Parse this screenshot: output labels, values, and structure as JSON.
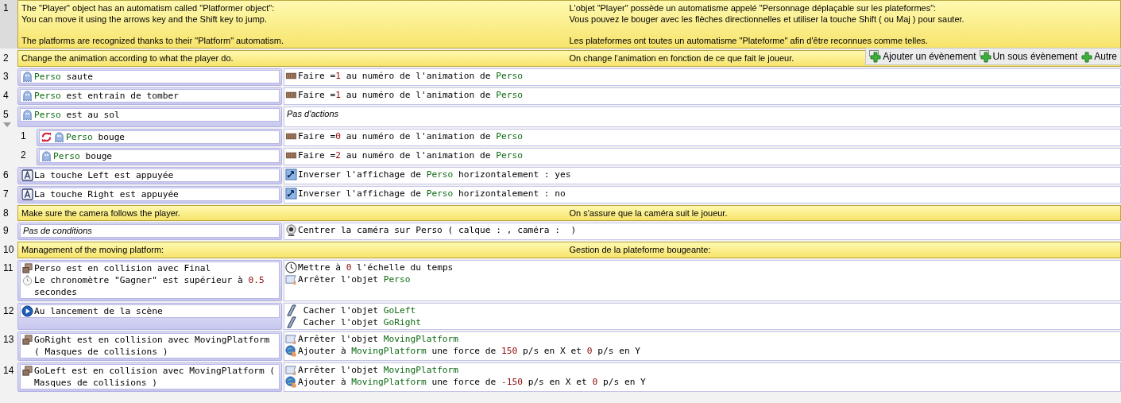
{
  "events": [
    {
      "kind": "comment",
      "number": "1",
      "en": "The \"Player\" object has an automatism called \"Platformer object\":\nYou can move it using the arrows key and the Shift key to jump.\n\nThe platforms are recognized thanks to their \"Platform\" automatism.",
      "fr": "L'objet \"Player\" possède un automatisme appelé \"Personnage déplaçable sur les plateformes\":\nVous pouvez le bouger avec les flèches directionnelles et utiliser la touche Shift ( ou Maj ) pour sauter.\n\nLes plateformes ont toutes un automatisme \"Plateforme\" afin d'être reconnues comme telles."
    },
    {
      "kind": "comment",
      "number": "2",
      "en": "Change the animation according to what the player do.",
      "fr": "On change l'animation en fonction de ce que fait le joueur.",
      "toolbar": [
        "Ajouter un évènement",
        "Un sous évènement",
        "Autre"
      ]
    },
    {
      "kind": "standard",
      "number": "3",
      "expanded": false,
      "conditions": [
        {
          "kind": "sprite",
          "once": false,
          "parts": [
            {
              "object": "Perso"
            },
            " saute"
          ]
        }
      ],
      "actions": [
        {
          "kind": "animation",
          "parts": [
            "Faire =",
            {
              "value": "1"
            },
            " au numéro de l'animation de ",
            {
              "object": "Perso"
            }
          ]
        }
      ]
    },
    {
      "kind": "standard",
      "number": "4",
      "expanded": false,
      "conditions": [
        {
          "kind": "sprite",
          "once": false,
          "parts": [
            {
              "object": "Perso"
            },
            " est entrain de tomber"
          ]
        }
      ],
      "actions": [
        {
          "kind": "animation",
          "parts": [
            "Faire =",
            {
              "value": "1"
            },
            " au numéro de l'animation de ",
            {
              "object": "Perso"
            }
          ]
        }
      ]
    },
    {
      "kind": "standard",
      "number": "5",
      "expanded": true,
      "conditions": [
        {
          "kind": "sprite",
          "once": false,
          "parts": [
            {
              "object": "Perso"
            },
            " est au sol"
          ]
        }
      ],
      "actions": [
        {
          "kind": "none",
          "parts": [
            "Pas d'actions"
          ]
        }
      ],
      "children": [
        {
          "number": "1",
          "conditions": [
            {
              "kind": "sprite",
              "once": true,
              "parts": [
                {
                  "object": "Perso"
                },
                " bouge"
              ]
            }
          ],
          "actions": [
            {
              "kind": "animation",
              "parts": [
                "Faire =",
                {
                  "value": "0"
                },
                " au numéro de l'animation de ",
                {
                  "object": "Perso"
                }
              ]
            }
          ]
        },
        {
          "number": "2",
          "conditions": [
            {
              "kind": "sprite",
              "once": false,
              "parts": [
                {
                  "object": "Perso"
                },
                " bouge"
              ]
            }
          ],
          "actions": [
            {
              "kind": "animation",
              "parts": [
                "Faire =",
                {
                  "value": "2"
                },
                " au numéro de l'animation de ",
                {
                  "object": "Perso"
                }
              ]
            }
          ]
        }
      ]
    },
    {
      "kind": "standard",
      "number": "6",
      "expanded": false,
      "conditions": [
        {
          "kind": "key",
          "once": false,
          "parts": [
            "La touche Left est appuyée"
          ]
        }
      ],
      "actions": [
        {
          "kind": "flip",
          "parts": [
            "Inverser l'affichage de ",
            {
              "object": "Perso"
            },
            " horizontalement : yes"
          ]
        }
      ]
    },
    {
      "kind": "standard",
      "number": "7",
      "expanded": false,
      "conditions": [
        {
          "kind": "key",
          "once": false,
          "parts": [
            "La touche Right est appuyée"
          ]
        }
      ],
      "actions": [
        {
          "kind": "flip",
          "parts": [
            "Inverser l'affichage de ",
            {
              "object": "Perso"
            },
            " horizontalement : no"
          ]
        }
      ]
    },
    {
      "kind": "comment",
      "number": "8",
      "en": "Make sure the camera follows the player.",
      "fr": "On s'assure que la caméra suit le joueur."
    },
    {
      "kind": "standard",
      "number": "9",
      "expanded": false,
      "conditions": [
        {
          "kind": "none",
          "parts": [
            "Pas de conditions"
          ]
        }
      ],
      "actions": [
        {
          "kind": "camera",
          "parts": [
            "Centrer la caméra sur Perso ( calque : , caméra :  )"
          ]
        }
      ]
    },
    {
      "kind": "comment",
      "number": "10",
      "en": "Management of the moving platform:",
      "fr": "Gestion de la plateforme bougeante:"
    },
    {
      "kind": "standard",
      "number": "11",
      "expanded": false,
      "conditions": [
        {
          "kind": "collision",
          "once": false,
          "parts": [
            "Perso est en collision avec Final"
          ]
        },
        {
          "kind": "timer",
          "once": false,
          "parts": [
            "Le chronomètre \"Gagner\" est supérieur à ",
            {
              "value": "0.5"
            },
            " secondes"
          ]
        }
      ],
      "actions": [
        {
          "kind": "timescale",
          "parts": [
            "Mettre à ",
            {
              "value": "0"
            },
            " l'échelle du temps"
          ]
        },
        {
          "kind": "stop",
          "parts": [
            "Arrêter l'objet ",
            {
              "object": "Perso"
            }
          ]
        }
      ]
    },
    {
      "kind": "standard",
      "number": "12",
      "expanded": false,
      "conditions": [
        {
          "kind": "scene_start",
          "once": false,
          "parts": [
            "Au lancement de la scène"
          ]
        }
      ],
      "actions": [
        {
          "kind": "hide",
          "parts": [
            " Cacher l'objet ",
            {
              "object": "GoLeft"
            }
          ]
        },
        {
          "kind": "hide",
          "parts": [
            " Cacher l'objet ",
            {
              "object": "GoRight"
            }
          ]
        }
      ]
    },
    {
      "kind": "standard",
      "number": "13",
      "expanded": false,
      "conditions": [
        {
          "kind": "collision",
          "once": false,
          "parts": [
            "GoRight est en collision avec MovingPlatform ( Masques de collisions )"
          ]
        }
      ],
      "actions": [
        {
          "kind": "stop",
          "parts": [
            "Arrêter l'objet ",
            {
              "object": "MovingPlatform"
            }
          ]
        },
        {
          "kind": "force",
          "parts": [
            "Ajouter à ",
            {
              "object": "MovingPlatform"
            },
            " une force de ",
            {
              "value": "150"
            },
            " p/s en X et ",
            {
              "value": "0"
            },
            " p/s en Y"
          ]
        }
      ]
    },
    {
      "kind": "standard",
      "number": "14",
      "expanded": false,
      "conditions": [
        {
          "kind": "collision",
          "once": false,
          "parts": [
            "GoLeft est en collision avec MovingPlatform ( Masques de collisions )"
          ]
        }
      ],
      "actions": [
        {
          "kind": "stop",
          "parts": [
            "Arrêter l'objet ",
            {
              "object": "MovingPlatform"
            }
          ]
        },
        {
          "kind": "force",
          "parts": [
            "Ajouter à ",
            {
              "object": "MovingPlatform"
            },
            " une force de ",
            {
              "value": "-150"
            },
            " p/s en X et ",
            {
              "value": "0"
            },
            " p/s en Y"
          ]
        }
      ]
    }
  ]
}
